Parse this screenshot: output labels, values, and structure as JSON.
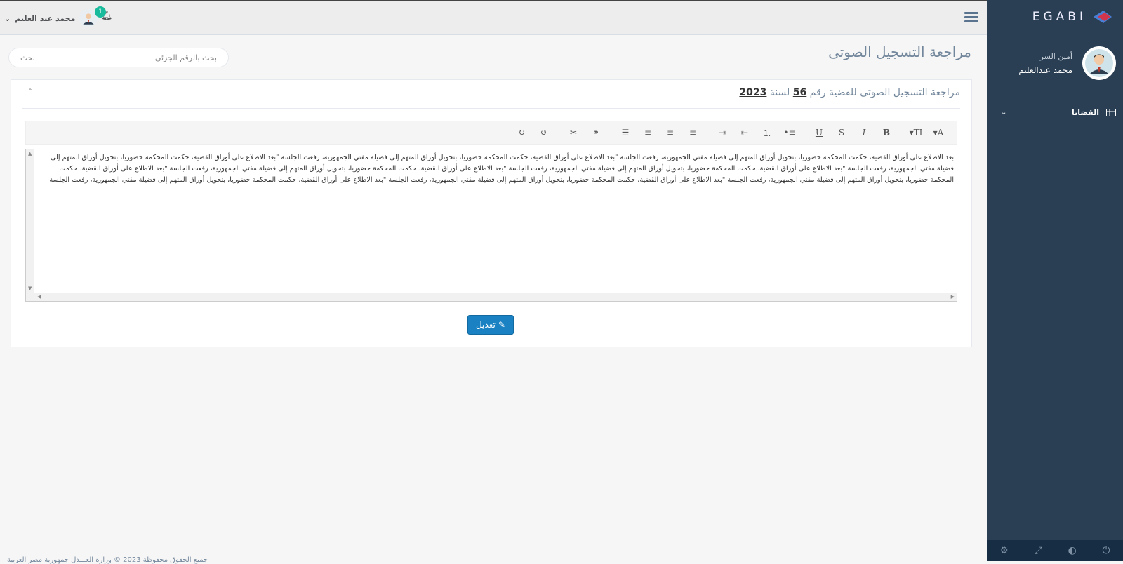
{
  "sidebar": {
    "brand": "EGABI",
    "role": "أمين السر",
    "username": "محمد عبدالعليم",
    "menu": [
      {
        "label": "القضايا",
        "icon": "table-icon"
      }
    ],
    "footer_icons": [
      "power-icon",
      "eye-slash-icon",
      "fullscreen-icon",
      "gear-icon"
    ]
  },
  "topnav": {
    "username": "محمد عبد العليم",
    "notifications_count": "1"
  },
  "main": {
    "page_title": "مراجعة التسجيل الصوتى",
    "search_label": "بحث بالرقم الجزئى",
    "search_placeholder": "بحث",
    "panel_title_prefix": "مراجعة التسجيل الصوتى للقضية رقم",
    "case_number": "56",
    "year_label": "لسنة",
    "case_year": "2023",
    "editor_text": "بعد الاطلاع على أوراق القضية، حكمت المحكمة حضوريا، بتحويل أوراق المتهم إلى فضيلة مفتي الجمهورية، رفعت الجلسة \"بعد الاطلاع على أوراق القضية، حكمت المحكمة حضوريا، بتحويل أوراق المتهم إلى فضيلة مفتي الجمهورية، رفعت الجلسة \"بعد الاطلاع على أوراق القضية، حكمت المحكمة حضوريا، بتحويل أوراق المتهم إلى فضيلة مفتي الجمهورية، رفعت الجلسة \"بعد الاطلاع على أوراق القضية، حكمت المحكمة حضوريا، بتحويل أوراق المتهم إلى فضيلة مفتي الجمهورية، رفعت الجلسة \"بعد الاطلاع على أوراق القضية، حكمت المحكمة حضوريا، بتحويل أوراق المتهم إلى فضيلة مفتي الجمهورية، رفعت الجلسة \"بعد الاطلاع على أوراق القضية، حكمت المحكمة حضوريا، بتحويل أوراق المتهم إلى فضيلة مفتي الجمهورية، رفعت الجلسة \"بعد الاطلاع على أوراق القضية، حكمت المحكمة حضوريا، بتحويل أوراق المتهم إلى فضيلة مفتي الجمهورية، رفعت الجلسة \"بعد الاطلاع على أوراق القضية، حكمت المحكمة حضوريا، بتحويل أوراق المتهم إلى فضيلة مفتي الجمهورية، رفعت الجلسة",
    "edit_button": "تعديل"
  },
  "footer": {
    "text": "جميع الحقوق محفوظة 2023 © وزارة العـــدل جمهورية مصر العربية"
  },
  "colors": {
    "sidebar_bg": "#2a3f54",
    "primary_button": "#1a82c3",
    "badge": "#1abb9c"
  }
}
